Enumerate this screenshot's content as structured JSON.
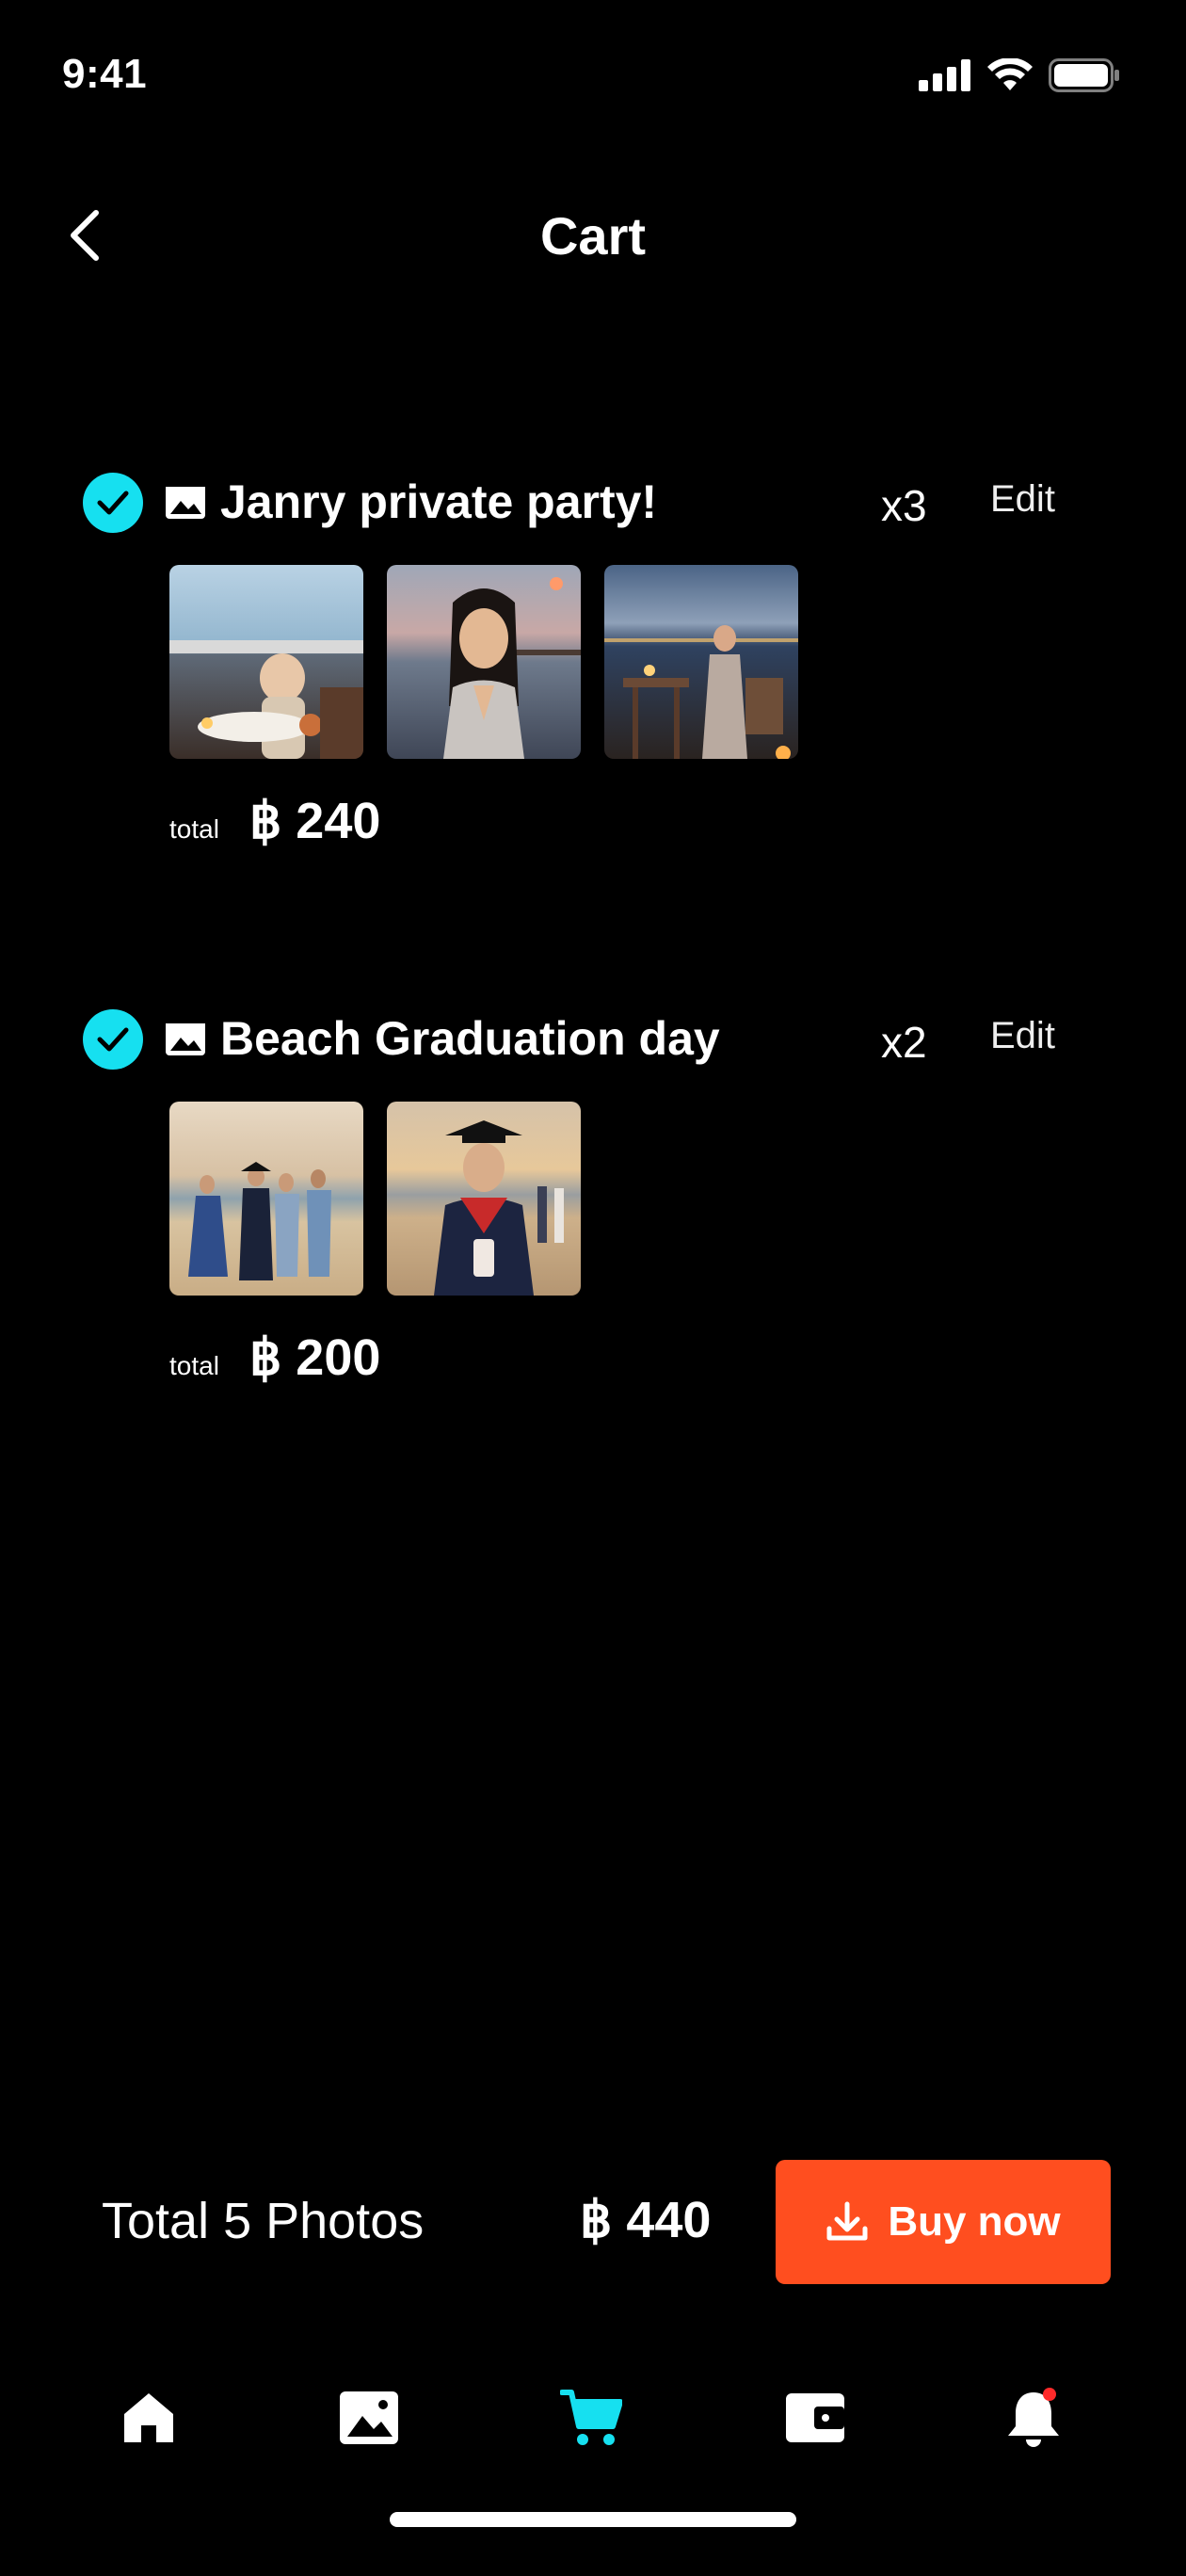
{
  "status_bar": {
    "time": "9:41"
  },
  "nav": {
    "title": "Cart"
  },
  "albums": [
    {
      "title": "Janry private party!",
      "quantity": "x3",
      "edit_label": "Edit",
      "total_label": "total",
      "total_value": "฿ 240"
    },
    {
      "title": "Beach Graduation day",
      "quantity": "x2",
      "edit_label": "Edit",
      "total_label": "total",
      "total_value": "฿ 200"
    }
  ],
  "summary": {
    "label": "Total 5 Photos",
    "amount": "฿ 440",
    "buy_label": "Buy now"
  },
  "tabbar": {
    "active_tab": "cart",
    "items": [
      "home",
      "gallery",
      "cart",
      "wallet",
      "notifications"
    ]
  },
  "colors": {
    "accent": "#16e0f0",
    "buy_button": "#ff4e1f",
    "notification_dot": "#ff2a2a"
  }
}
